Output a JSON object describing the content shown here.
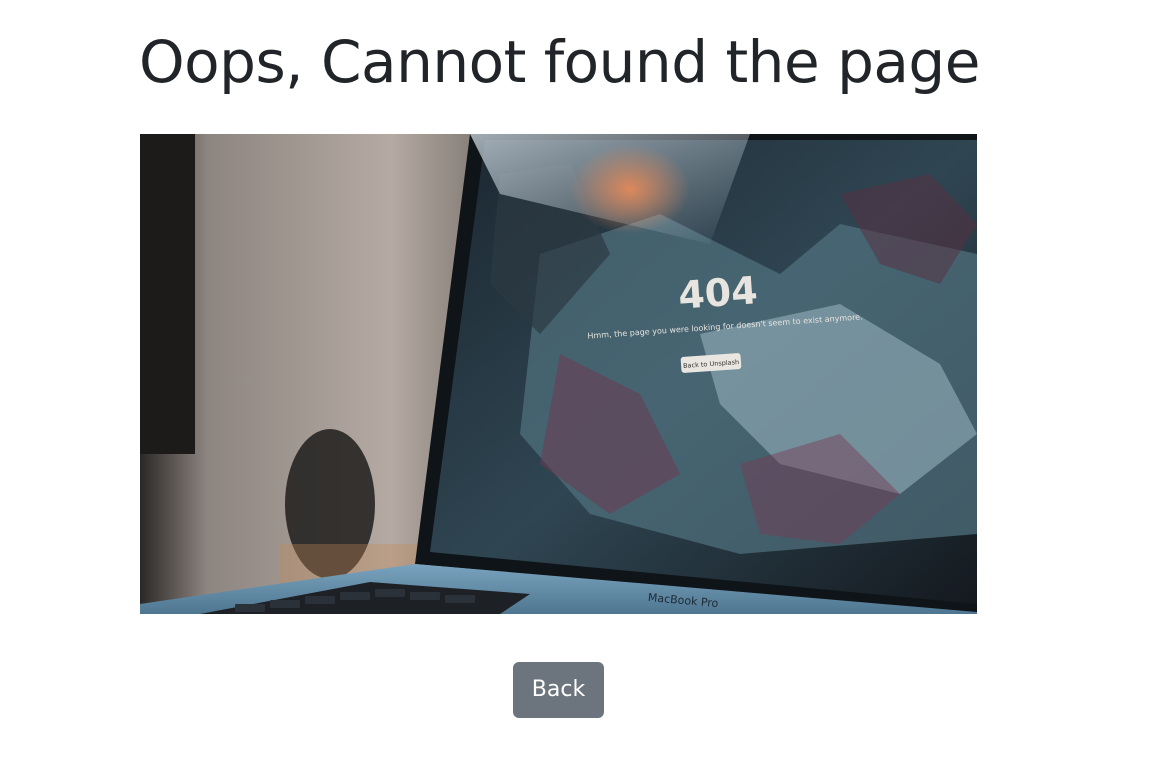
{
  "page": {
    "title": "Oops, Cannot found the page"
  },
  "hero_image": {
    "screen_code": "404",
    "screen_message": "Hmm, the page you were looking for doesn't seem to exist anymore.",
    "screen_button": "Back to Unsplash",
    "laptop_brand": "MacBook Pro"
  },
  "actions": {
    "back_label": "Back"
  },
  "colors": {
    "title": "#212529",
    "button_bg": "#6c757d",
    "button_text": "#ffffff"
  }
}
